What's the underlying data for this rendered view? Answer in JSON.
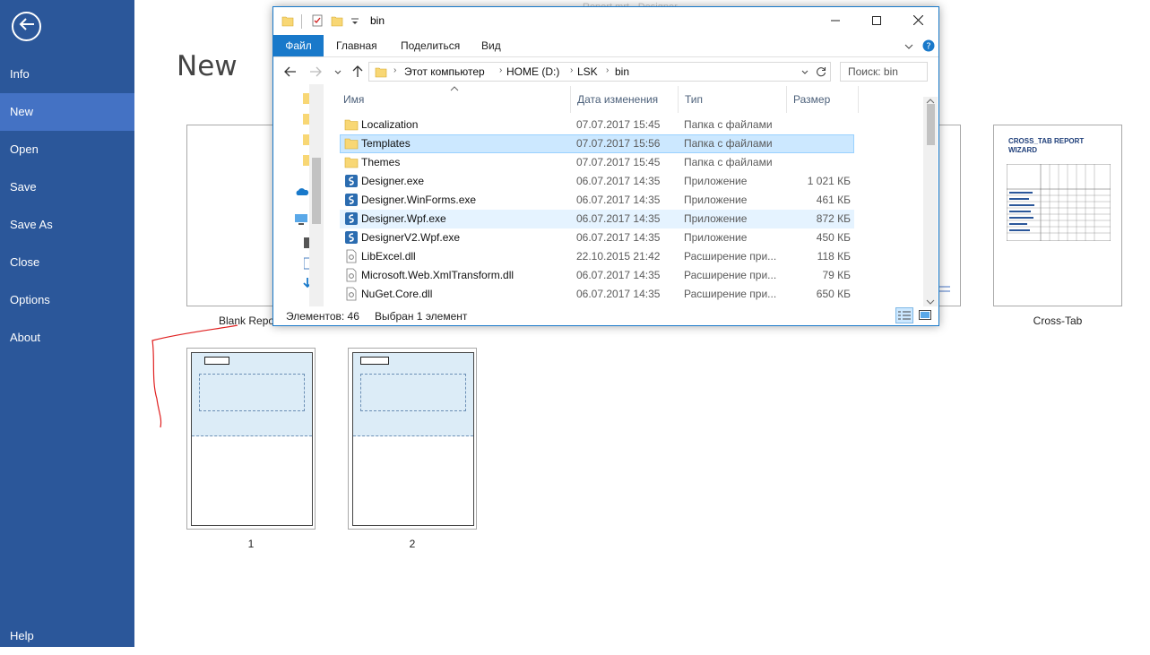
{
  "app": {
    "bg_title": "Report.mrt - Designer"
  },
  "sidebar": {
    "items": [
      {
        "label": "Info"
      },
      {
        "label": "New"
      },
      {
        "label": "Open"
      },
      {
        "label": "Save"
      },
      {
        "label": "Save As"
      },
      {
        "label": "Close"
      },
      {
        "label": "Options"
      },
      {
        "label": "About"
      }
    ],
    "help_label": "Help"
  },
  "page": {
    "title": "New"
  },
  "templates": [
    {
      "label": "Blank Report"
    },
    {
      "label": "Cross-Tab"
    },
    {
      "label": "1"
    },
    {
      "label": "2"
    }
  ],
  "crosstab_preview": {
    "title_line1": "CROSS_TAB REPORT",
    "title_line2": "WIZARD"
  },
  "explorer": {
    "title": "bin",
    "ribbon_tabs": [
      "Файл",
      "Главная",
      "Поделиться",
      "Вид"
    ],
    "breadcrumb": [
      "Этот компьютер",
      "HOME (D:)",
      "LSK",
      "bin"
    ],
    "search_placeholder": "Поиск: bin",
    "columns": [
      "Имя",
      "Дата изменения",
      "Тип",
      "Размер"
    ],
    "files": [
      {
        "name": "Localization",
        "date": "07.07.2017 15:45",
        "type": "Папка с файлами",
        "size": "",
        "icon": "folder-icon"
      },
      {
        "name": "Templates",
        "date": "07.07.2017 15:56",
        "type": "Папка с файлами",
        "size": "",
        "icon": "folder-icon"
      },
      {
        "name": "Themes",
        "date": "07.07.2017 15:45",
        "type": "Папка с файлами",
        "size": "",
        "icon": "folder-icon"
      },
      {
        "name": "Designer.exe",
        "date": "06.07.2017 14:35",
        "type": "Приложение",
        "size": "1 021 КБ",
        "icon": "app-icon"
      },
      {
        "name": "Designer.WinForms.exe",
        "date": "06.07.2017 14:35",
        "type": "Приложение",
        "size": "461 КБ",
        "icon": "app-icon"
      },
      {
        "name": "Designer.Wpf.exe",
        "date": "06.07.2017 14:35",
        "type": "Приложение",
        "size": "872 КБ",
        "icon": "app-icon"
      },
      {
        "name": "DesignerV2.Wpf.exe",
        "date": "06.07.2017 14:35",
        "type": "Приложение",
        "size": "450 КБ",
        "icon": "app-icon"
      },
      {
        "name": "LibExcel.dll",
        "date": "22.10.2015 21:42",
        "type": "Расширение при...",
        "size": "118 КБ",
        "icon": "dll-icon"
      },
      {
        "name": "Microsoft.Web.XmlTransform.dll",
        "date": "06.07.2017 14:35",
        "type": "Расширение при...",
        "size": "79 КБ",
        "icon": "dll-icon"
      },
      {
        "name": "NuGet.Core.dll",
        "date": "06.07.2017 14:35",
        "type": "Расширение при...",
        "size": "650 КБ",
        "icon": "dll-icon"
      }
    ],
    "status_count": "Элементов: 46",
    "status_selected": "Выбран 1 элемент"
  },
  "colors": {
    "sidebar": "#2b579a",
    "sidebar_active": "#4472c4",
    "explorer_accent": "#1979ca",
    "selection": "#cce8ff",
    "folder": "#f8d775",
    "annotation": "#e02020"
  }
}
